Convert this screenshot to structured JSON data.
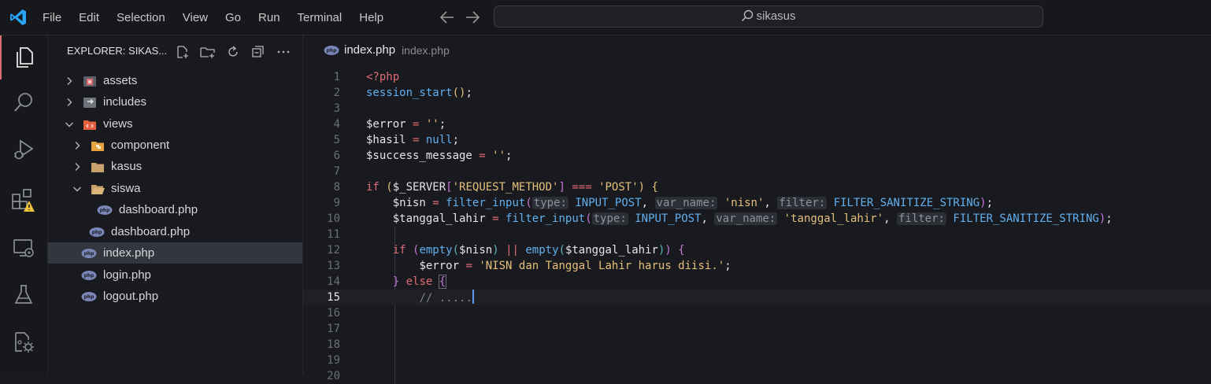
{
  "menu": [
    "File",
    "Edit",
    "Selection",
    "View",
    "Go",
    "Run",
    "Terminal",
    "Help"
  ],
  "search": {
    "text": "sikasus"
  },
  "activity": [
    "explorer-icon",
    "search-icon",
    "run-debug-icon",
    "extensions-icon",
    "remote-explorer-icon",
    "testing-icon",
    "settings-sync-icon"
  ],
  "explorer": {
    "title": "EXPLORER: SIKAS...",
    "items": [
      {
        "label": "assets",
        "depth": 0,
        "type": "folder",
        "state": "collapsed"
      },
      {
        "label": "includes",
        "depth": 0,
        "type": "folder",
        "state": "collapsed"
      },
      {
        "label": "views",
        "depth": 0,
        "type": "folder",
        "state": "expanded"
      },
      {
        "label": "component",
        "depth": 1,
        "type": "folder",
        "state": "collapsed"
      },
      {
        "label": "kasus",
        "depth": 1,
        "type": "folder",
        "state": "collapsed"
      },
      {
        "label": "siswa",
        "depth": 1,
        "type": "folder",
        "state": "expanded"
      },
      {
        "label": "dashboard.php",
        "depth": 2,
        "type": "php"
      },
      {
        "label": "dashboard.php",
        "depth": 1,
        "type": "php"
      },
      {
        "label": "index.php",
        "depth": 0,
        "type": "php",
        "selected": true
      },
      {
        "label": "login.php",
        "depth": 0,
        "type": "php"
      },
      {
        "label": "logout.php",
        "depth": 0,
        "type": "php"
      }
    ]
  },
  "tab": {
    "name": "index.php",
    "desc": "index.php"
  },
  "code": {
    "line_numbers": [
      "1",
      "2",
      "3",
      "4",
      "5",
      "6",
      "7",
      "8",
      "9",
      "10",
      "11",
      "12",
      "13",
      "14",
      "15",
      "16",
      "17",
      "18",
      "19",
      "20"
    ],
    "current_line": "15",
    "t": {
      "php_open": "<?php",
      "session_start": "session_start",
      "paren_open": "(",
      "paren_close": ")",
      "semi": ";",
      "var_error": "$error",
      "var_hasil": "$hasil",
      "var_success": "$success_message",
      "assign": " = ",
      "empty_str": "''",
      "null": "null",
      "if": "if",
      "server": "$_SERVER",
      "bracket_open": "[",
      "bracket_close": "]",
      "req_method": "'REQUEST_METHOD'",
      "strict_eq": " === ",
      "post": "'POST'",
      "brace_open": "{",
      "brace_close": "}",
      "var_nisn": "$nisn",
      "var_tanggal": "$tanggal_lahir",
      "filter_input": "filter_input",
      "hint_type": "type:",
      "hint_var": "var_name:",
      "hint_filter": "filter:",
      "input_post": "INPUT_POST",
      "comma": ", ",
      "nisn_str": "'nisn'",
      "tanggal_str": "'tanggal_lahir'",
      "sanitize": "FILTER_SANITIZE_STRING",
      "empty_fn": "empty",
      "or": " || ",
      "err_msg": "'NISN dan Tanggal Lahir harus diisi.'",
      "else": "else",
      "comment": "// ....."
    }
  }
}
